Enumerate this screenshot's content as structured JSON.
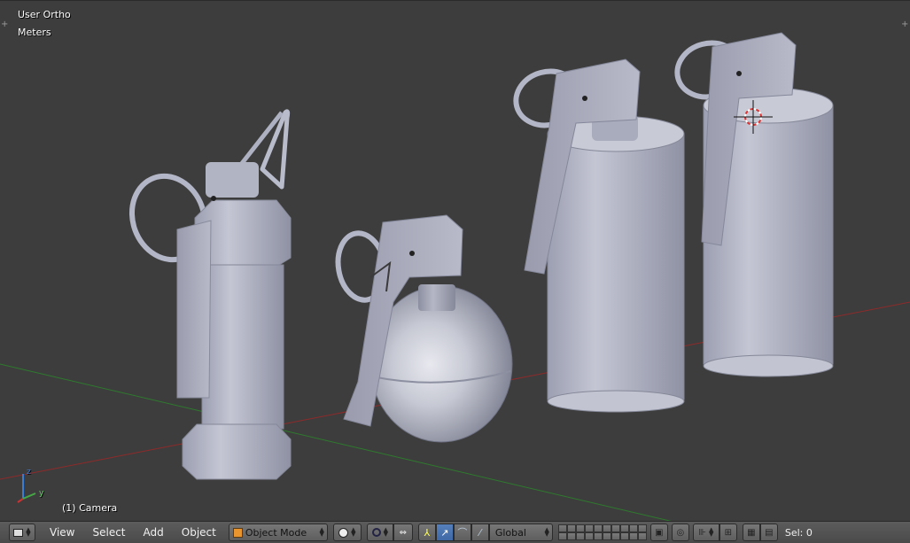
{
  "viewport": {
    "view_name": "User Ortho",
    "units": "Meters",
    "active_object": "(1) Camera",
    "axis_x_label": "y",
    "axis_z_label": "z",
    "corner_plus": "+"
  },
  "header": {
    "menu": [
      "View",
      "Select",
      "Add",
      "Object"
    ],
    "mode_label": "Object Mode",
    "orientation_label": "Global",
    "selection_label": "Sel: 0"
  },
  "colors": {
    "viewport_bg": "#3d3d3d",
    "header_bg": "#4e4e4e",
    "x_axis": "#8f2a2a",
    "y_axis": "#2e7a2e",
    "model": "#b7b9c8",
    "active_button": "#5580bb"
  },
  "icons": [
    "editor-type-icon",
    "cube-icon",
    "sphere-shading-icon",
    "pivot-icon",
    "manipulator-icon",
    "translate-icon",
    "rotate-icon",
    "scale-icon",
    "layers-icon",
    "lock-icon",
    "proportional-edit-icon",
    "snap-icon",
    "render-icon",
    "clapper-icon"
  ]
}
